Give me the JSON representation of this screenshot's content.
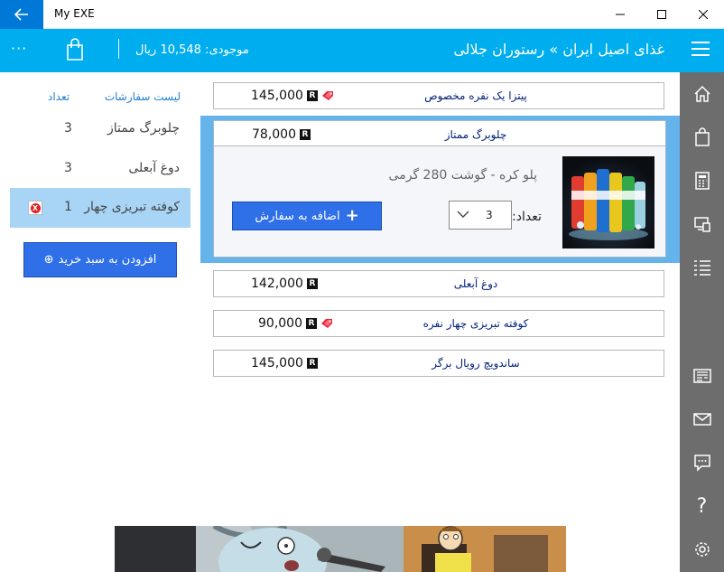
{
  "window": {
    "title": "My EXE"
  },
  "header": {
    "title": "غذای اصیل ایران » رستوران جلالی",
    "balance": "موجودی: 10,548 ریال",
    "more_glyph": "···"
  },
  "orders": {
    "list_label": "لیست سفارشات",
    "qty_label": "تعداد",
    "items": [
      {
        "name": "چلوبرگ ممتاز",
        "qty": "3"
      },
      {
        "name": "دوغ آبعلی",
        "qty": "3"
      },
      {
        "name": "کوفته تبریزی چهار",
        "qty": "1",
        "remove_glyph": "X"
      }
    ],
    "add_to_cart_label": "افزودن به سبد خرید",
    "add_to_cart_glyph": "⊕"
  },
  "menu": {
    "currency_badge": "R",
    "items": [
      {
        "name": "پیتزا یک نفره مخصوص",
        "price": "145,000",
        "tag": true
      },
      {
        "name": "چلوبرگ ممتاز",
        "price": "78,000",
        "tag": false
      },
      {
        "name": "دوغ آبعلی",
        "price": "142,000",
        "tag": false
      },
      {
        "name": "کوفته تبریزی چهار نفره",
        "price": "90,000",
        "tag": true
      },
      {
        "name": "ساندویچ رویال برگر",
        "price": "145,000",
        "tag": false
      }
    ],
    "expanded": {
      "description": "پلو کره - گوشت 280 گرمی",
      "qty_label": "تعداد:",
      "qty_value": "3",
      "add_label": "اضافه به سفارش",
      "add_glyph": "+"
    }
  },
  "rail": {
    "icons": [
      "home-icon",
      "bag-icon",
      "calculator-icon",
      "devices-icon",
      "list-icon",
      "news-icon",
      "mail-icon",
      "feedback-icon",
      "help-icon",
      "settings-icon"
    ],
    "help_glyph": "?"
  },
  "colors": {
    "accent": "#00aeef",
    "back": "#0078d7",
    "button": "#2f6fe8",
    "selection": "#a8d4f5",
    "rail": "#6d6d6d"
  }
}
